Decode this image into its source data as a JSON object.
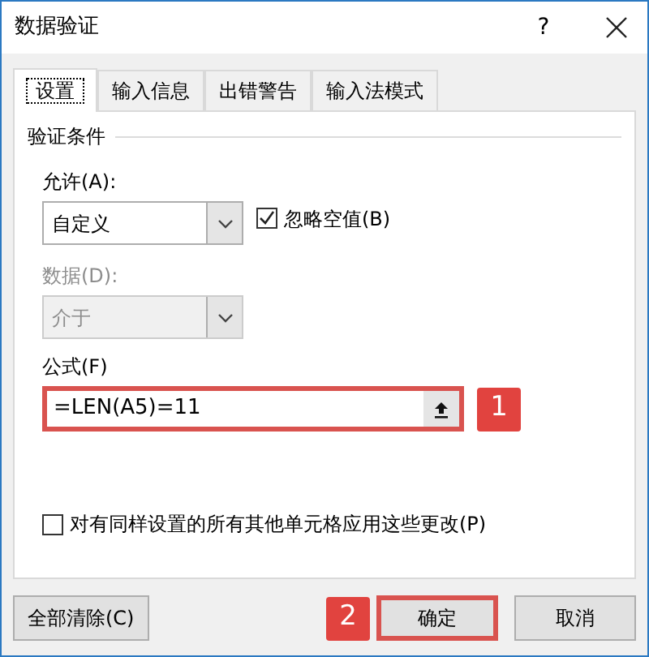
{
  "window": {
    "title": "数据验证",
    "help": "?"
  },
  "tabs": [
    {
      "label": "设置",
      "selected": true
    },
    {
      "label": "输入信息",
      "selected": false
    },
    {
      "label": "出错警告",
      "selected": false
    },
    {
      "label": "输入法模式",
      "selected": false
    }
  ],
  "settings": {
    "group_title": "验证条件",
    "allow": {
      "label": "允许(A):",
      "value": "自定义",
      "disabled": false
    },
    "ignore_blank": {
      "label": "忽略空值(B)",
      "checked": true
    },
    "data": {
      "label": "数据(D):",
      "value": "介于",
      "disabled": true
    },
    "formula": {
      "label": "公式(F)",
      "value": "=LEN(A5)=11",
      "highlighted": true,
      "callout": "1"
    },
    "apply_all": {
      "label": "对有同样设置的所有其他单元格应用这些更改(P)",
      "checked": false
    }
  },
  "buttons": [
    {
      "label": "全部清除(C)",
      "highlighted": false
    },
    {
      "label": "确定",
      "highlighted": true,
      "callout": "2"
    },
    {
      "label": "取消",
      "highlighted": false
    }
  ]
}
